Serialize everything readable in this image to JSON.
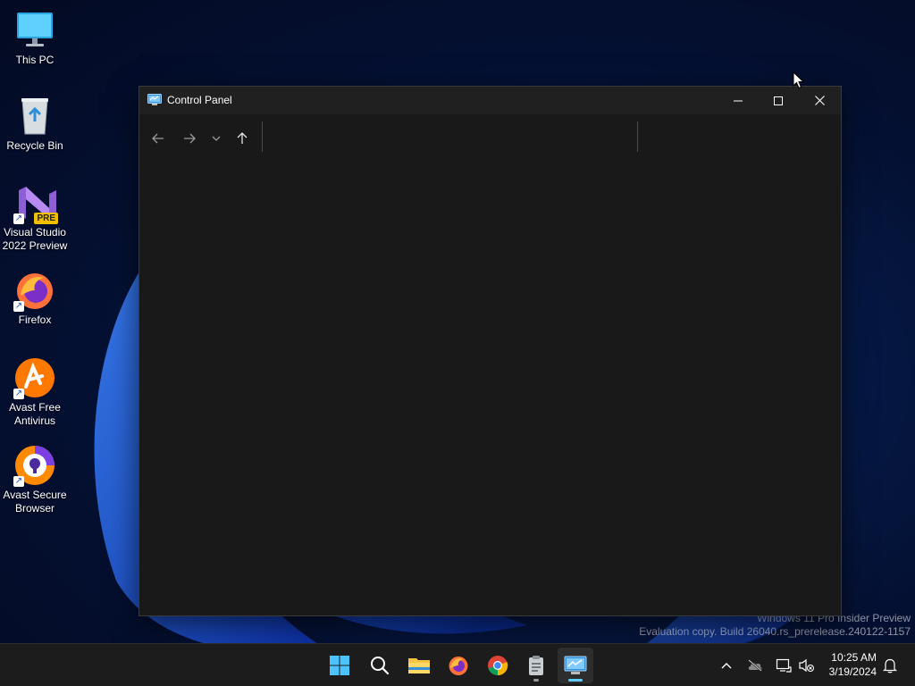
{
  "desktop": {
    "icons": [
      {
        "label_line1": "This PC",
        "label_line2": ""
      },
      {
        "label_line1": "Recycle Bin",
        "label_line2": ""
      },
      {
        "label_line1": "Visual Studio",
        "label_line2": "2022 Preview",
        "badge": "PRE"
      },
      {
        "label_line1": "Firefox",
        "label_line2": ""
      },
      {
        "label_line1": "Avast Free",
        "label_line2": "Antivirus"
      },
      {
        "label_line1": "Avast Secure",
        "label_line2": "Browser"
      }
    ],
    "shortcut_arrow": "↗"
  },
  "window": {
    "title": "Control Panel",
    "icon": "control-panel-icon",
    "controls": [
      "minimize-icon",
      "maximize-icon",
      "close-icon"
    ],
    "nav": [
      "back-arrow-icon",
      "forward-arrow-icon",
      "chevron-down-icon",
      "up-arrow-icon"
    ],
    "address_value": "",
    "search_value": ""
  },
  "watermark": {
    "line1": "Windows 11 Pro Insider Preview",
    "line2": "Evaluation copy. Build 26040.rs_prerelease.240122-1157"
  },
  "taskbar": {
    "apps": [
      "start-icon",
      "search-icon",
      "file-explorer-icon",
      "firefox-icon",
      "chrome-icon",
      "clipboard-icon",
      "control-panel-icon"
    ],
    "active_app": "control-panel-icon",
    "tray": [
      "chevron-up-icon",
      "onedrive-icon",
      "network-icon",
      "volume-muted-icon",
      "notifications-icon"
    ],
    "time": "10:25 AM",
    "date": "3/19/2024"
  },
  "colors": {
    "accent": "#60cdff",
    "window_bg": "#191919",
    "titlebar_bg": "#202020",
    "taskbar_bg": "#1c1c1c"
  }
}
